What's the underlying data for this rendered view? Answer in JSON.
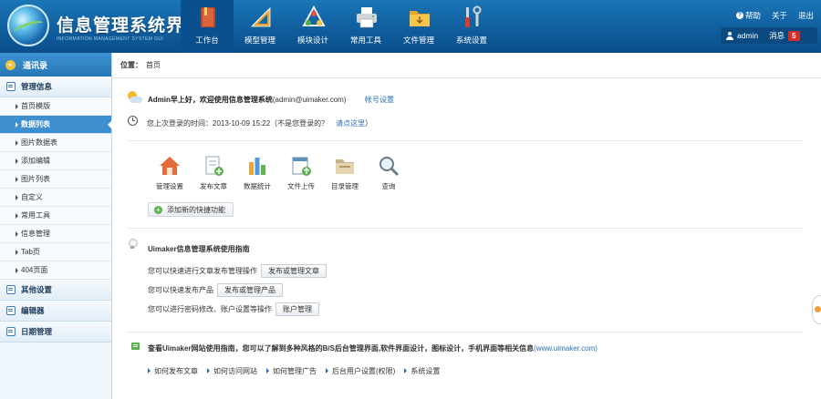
{
  "header": {
    "brand_title": "信息管理系统界面",
    "brand_subtitle": "INFORMATION MANAGEMENT SYSTEM GUI",
    "nav": [
      {
        "label": "工作台",
        "icon": "workbench-icon"
      },
      {
        "label": "模型管理",
        "icon": "model-ruler-icon"
      },
      {
        "label": "模块设计",
        "icon": "module-design-icon"
      },
      {
        "label": "常用工具",
        "icon": "printer-icon"
      },
      {
        "label": "文件管理",
        "icon": "folder-icon"
      },
      {
        "label": "系统设置",
        "icon": "wrench-screwdriver-icon"
      }
    ],
    "links": {
      "help": "帮助",
      "about": "关于",
      "logout": "退出"
    },
    "user": {
      "name": "admin",
      "message_label": "消息",
      "message_count": "5"
    },
    "colors": {
      "header_bg": "#0f5c9c",
      "active_nav": "#0a4f8e",
      "badge": "#d62b2b"
    }
  },
  "sidebar": {
    "header": "通讯录",
    "sections": [
      {
        "title": "管理信息",
        "items": [
          "首页模版",
          "数据列表",
          "图片数据表",
          "添加编辑",
          "图片列表",
          "自定义",
          "常用工具",
          "信息管理",
          "Tab页",
          "404页面"
        ]
      },
      {
        "title": "其他设置",
        "items": []
      },
      {
        "title": "编辑器",
        "items": []
      },
      {
        "title": "日期管理",
        "items": []
      }
    ],
    "active_item": "数据列表"
  },
  "breadcrumb": {
    "label": "位置：",
    "current": "首页"
  },
  "welcome": {
    "greeting": "Admin早上好，欢迎使用信息管理系统",
    "email": "(admin@uimaker.com)",
    "account_link": "帐号设置",
    "last_login": "您上次登录的时间：2013-10-09 15:22（不是您登录的？",
    "last_login_link": "请点这里",
    "last_login_close": "）"
  },
  "quick_actions": [
    {
      "label": "管理设置",
      "icon": "home-icon"
    },
    {
      "label": "发布文章",
      "icon": "publish-document-icon"
    },
    {
      "label": "数据统计",
      "icon": "bar-stats-icon"
    },
    {
      "label": "文件上传",
      "icon": "upload-icon"
    },
    {
      "label": "目录管理",
      "icon": "directory-folder-icon"
    },
    {
      "label": "查询",
      "icon": "search-icon"
    }
  ],
  "add_shortcut": "添加新的快捷功能",
  "guide": {
    "title": "Uimaker信息管理系统使用指南",
    "rows": [
      {
        "text": "您可以快速进行文章发布管理操作",
        "button": "发布或管理文章"
      },
      {
        "text": "您可以快速发布产品",
        "button": "发布或管理产品"
      },
      {
        "text": "您可以进行密码修改、账户设置等操作",
        "button": "账户管理"
      }
    ]
  },
  "info": {
    "text_bold": "查看Uimaker网站使用指南，您可以了解到多种风格的B/S后台管理界面,软件界面设计，图标设计，手机界面等相关信息",
    "text_tail": "(www.uimaker.com)",
    "links": [
      "如何发布文章",
      "如何访问网站",
      "如何管理广告",
      "后台用户设置(权限)",
      "系统设置"
    ]
  }
}
